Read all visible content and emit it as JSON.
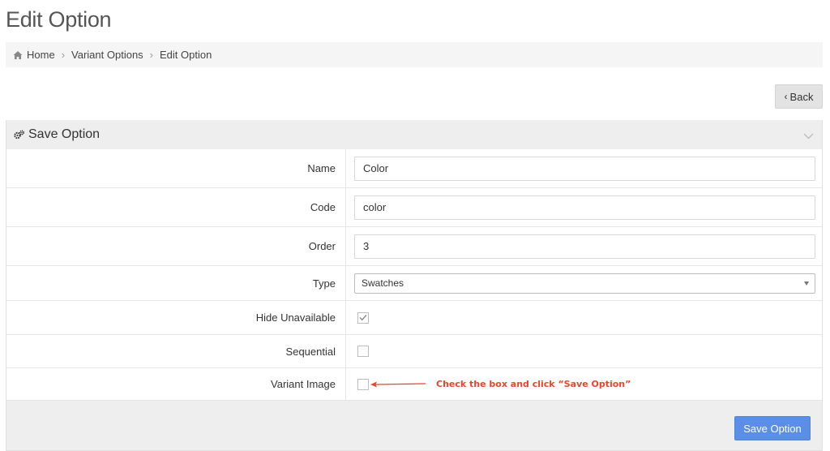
{
  "page": {
    "title": "Edit Option"
  },
  "breadcrumb": {
    "items": [
      {
        "label": "Home",
        "icon": "home-icon"
      },
      {
        "label": "Variant Options"
      },
      {
        "label": "Edit Option"
      }
    ],
    "separator": "›"
  },
  "toolbar": {
    "back_label": "Back",
    "back_icon": "chevron-left-icon"
  },
  "panel": {
    "title": "Save Option",
    "icon": "gears-icon",
    "collapse_icon": "chevron-down-icon"
  },
  "form": {
    "name": {
      "label": "Name",
      "value": "Color"
    },
    "code": {
      "label": "Code",
      "value": "color"
    },
    "order": {
      "label": "Order",
      "value": "3"
    },
    "type": {
      "label": "Type",
      "selected": "Swatches"
    },
    "hide_unavailable": {
      "label": "Hide Unavailable",
      "checked": true
    },
    "sequential": {
      "label": "Sequential",
      "checked": false
    },
    "variant_image": {
      "label": "Variant Image",
      "checked": false
    }
  },
  "annotation": {
    "text": "Check the box and click “Save Option”",
    "color": "#e8452a"
  },
  "footer": {
    "save_label": "Save Option",
    "save_color": "#5b8ee6"
  }
}
